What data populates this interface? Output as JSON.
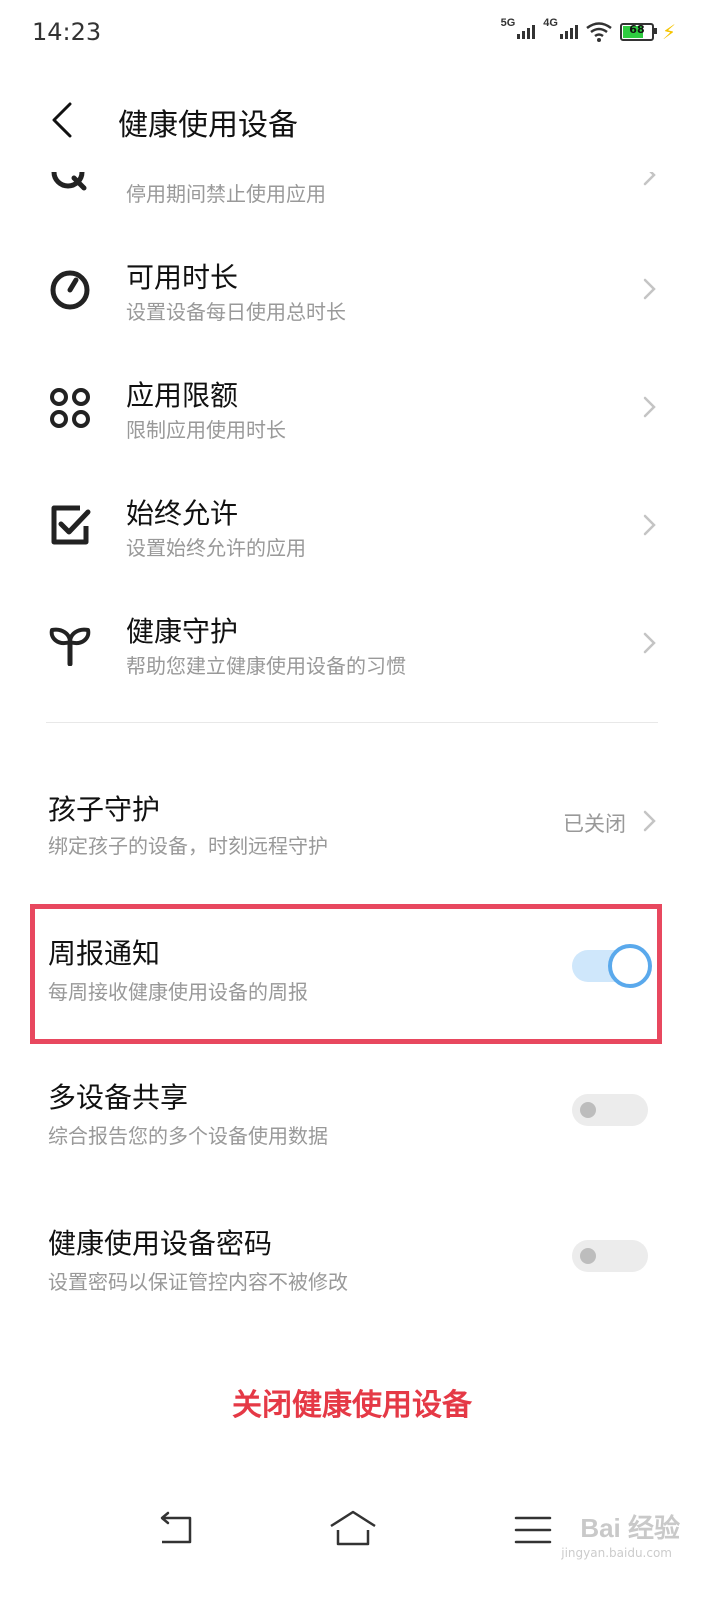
{
  "status_bar": {
    "time": "14:23",
    "network1": "5G",
    "network2": "4G",
    "battery": "68"
  },
  "header": {
    "title": "健康使用设备"
  },
  "feature_items": [
    {
      "title": "",
      "subtitle": "停用期间禁止使用应用",
      "icon": "downtime-icon"
    },
    {
      "title": "可用时长",
      "subtitle": "设置设备每日使用总时长",
      "icon": "gauge-icon"
    },
    {
      "title": "应用限额",
      "subtitle": "限制应用使用时长",
      "icon": "apps-grid-icon"
    },
    {
      "title": "始终允许",
      "subtitle": "设置始终允许的应用",
      "icon": "checkbox-icon"
    },
    {
      "title": "健康守护",
      "subtitle": "帮助您建立健康使用设备的习惯",
      "icon": "sprout-icon"
    }
  ],
  "settings": {
    "child_guard": {
      "title": "孩子守护",
      "subtitle": "绑定孩子的设备，时刻远程守护",
      "status": "已关闭"
    },
    "weekly_report": {
      "title": "周报通知",
      "subtitle": "每周接收健康使用设备的周报",
      "enabled": true
    },
    "multi_device": {
      "title": "多设备共享",
      "subtitle": "综合报告您的多个设备使用数据",
      "enabled": false
    },
    "password": {
      "title": "健康使用设备密码",
      "subtitle": "设置密码以保证管控内容不被修改",
      "enabled": false
    }
  },
  "close_button": "关闭健康使用设备",
  "watermark": {
    "brand": "Bai 经验",
    "url": "jingyan.baidu.com"
  },
  "colors": {
    "accent_red": "#e53946",
    "highlight_border": "#e8485f",
    "toggle_on": "#5aa9ec"
  }
}
